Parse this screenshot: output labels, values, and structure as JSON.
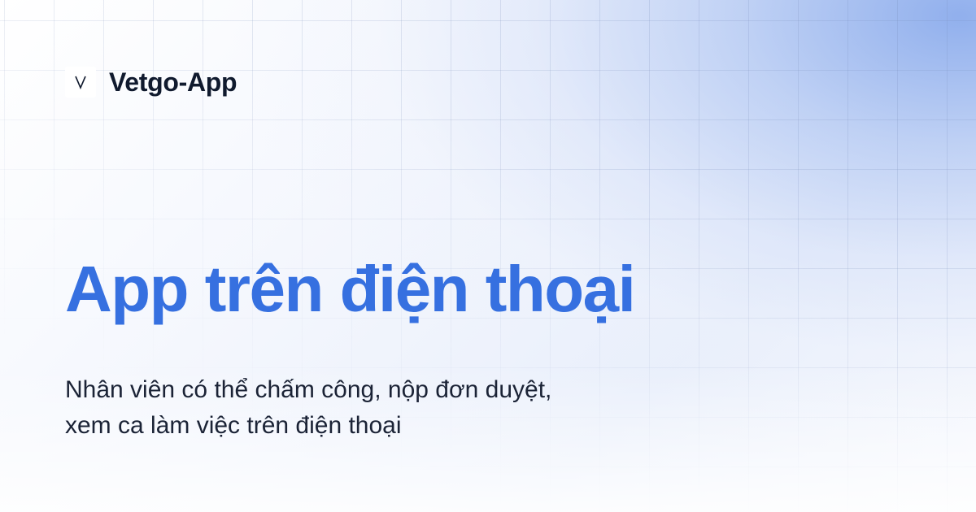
{
  "brand": {
    "logo_letter": "V",
    "name": "Vetgo-App"
  },
  "headline": "App trên điện thoại",
  "subtitle": {
    "line1": "Nhân viên có thể chấm công, nộp đơn duyệt,",
    "line2": "xem ca làm việc trên điện thoại"
  },
  "colors": {
    "headline": "#3670e0",
    "brand_text": "#101a2e",
    "body_text": "#1b2336",
    "glow": "#8cacec"
  }
}
